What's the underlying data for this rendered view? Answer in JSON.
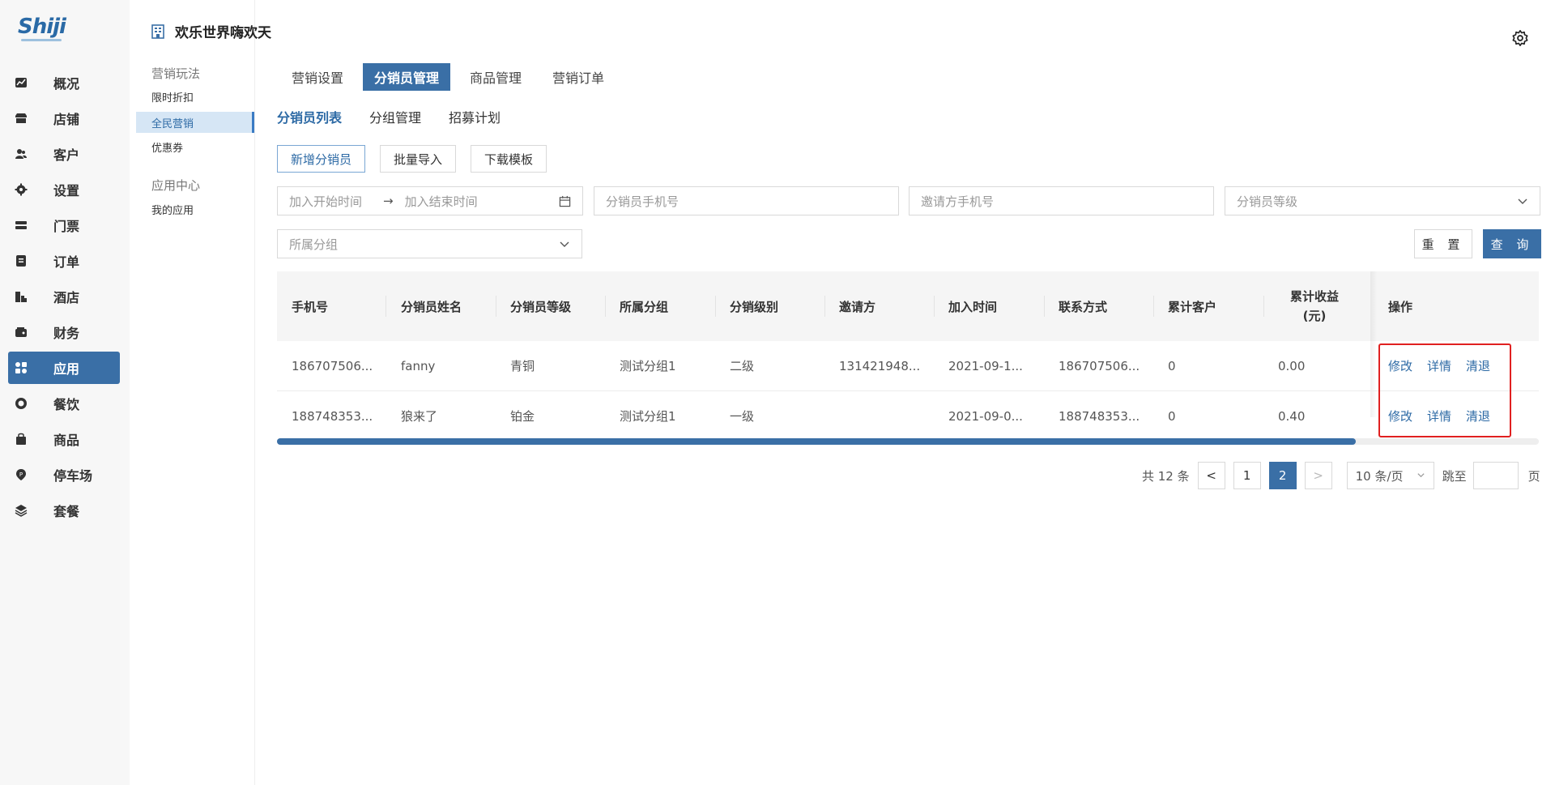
{
  "brand": {
    "logo_text": "Shiji"
  },
  "sidebar": {
    "items": [
      {
        "label": "概况",
        "icon": "chart-icon"
      },
      {
        "label": "店铺",
        "icon": "store-icon"
      },
      {
        "label": "客户",
        "icon": "users-icon"
      },
      {
        "label": "设置",
        "icon": "gear-icon"
      },
      {
        "label": "门票",
        "icon": "ticket-icon"
      },
      {
        "label": "订单",
        "icon": "order-icon"
      },
      {
        "label": "酒店",
        "icon": "hotel-icon"
      },
      {
        "label": "财务",
        "icon": "wallet-icon"
      },
      {
        "label": "应用",
        "icon": "apps-icon"
      },
      {
        "label": "餐饮",
        "icon": "dining-icon"
      },
      {
        "label": "商品",
        "icon": "bag-icon"
      },
      {
        "label": "停车场",
        "icon": "parking-icon"
      },
      {
        "label": "套餐",
        "icon": "layers-icon"
      }
    ],
    "active_index": 8
  },
  "subnav": {
    "store_name": "欢乐世界嗨欢天",
    "group1": "营销玩法",
    "items1": [
      "限时折扣",
      "全民营销",
      "优惠券"
    ],
    "group2": "应用中心",
    "items2": [
      "我的应用"
    ]
  },
  "main_tabs": [
    "营销设置",
    "分销员管理",
    "商品管理",
    "营销订单"
  ],
  "sub_tabs": [
    "分销员列表",
    "分组管理",
    "招募计划"
  ],
  "action_buttons": {
    "add": "新增分销员",
    "import": "批量导入",
    "download": "下载模板"
  },
  "filters": {
    "start_time": "加入开始时间",
    "end_time": "加入结束时间",
    "arrow": "→",
    "distributor_phone": "分销员手机号",
    "inviter_phone": "邀请方手机号",
    "level": "分销员等级",
    "group": "所属分组",
    "reset": "重 置",
    "query": "查 询"
  },
  "table": {
    "headers": [
      "手机号",
      "分销员姓名",
      "分销员等级",
      "所属分组",
      "分销级别",
      "邀请方",
      "加入时间",
      "联系方式",
      "累计客户",
      "累计收益",
      "(元)",
      "操作"
    ],
    "rows": [
      {
        "phone": "186707506...",
        "name": "fanny",
        "level": "青铜",
        "group": "测试分组1",
        "tier": "二级",
        "inviter": "131421948...",
        "joined": "2021-09-1...",
        "contact": "186707506...",
        "customers": "0",
        "income": "0.00"
      },
      {
        "phone": "188748353...",
        "name": "狼来了",
        "level": "铂金",
        "group": "测试分组1",
        "tier": "一级",
        "inviter": "",
        "joined": "2021-09-0...",
        "contact": "188748353...",
        "customers": "0",
        "income": "0.40"
      }
    ],
    "ops": {
      "edit": "修改",
      "detail": "详情",
      "clear": "清退"
    },
    "scroll_fraction": 0.855
  },
  "pagination": {
    "total": "共 12 条",
    "prev": "<",
    "pages": [
      "1",
      "2"
    ],
    "current": "2",
    "next": ">",
    "page_size": "10 条/页",
    "jump_label": "跳至",
    "jump_suffix": "页"
  },
  "colors": {
    "primary": "#3a6fa6",
    "highlight": "#e02020"
  }
}
